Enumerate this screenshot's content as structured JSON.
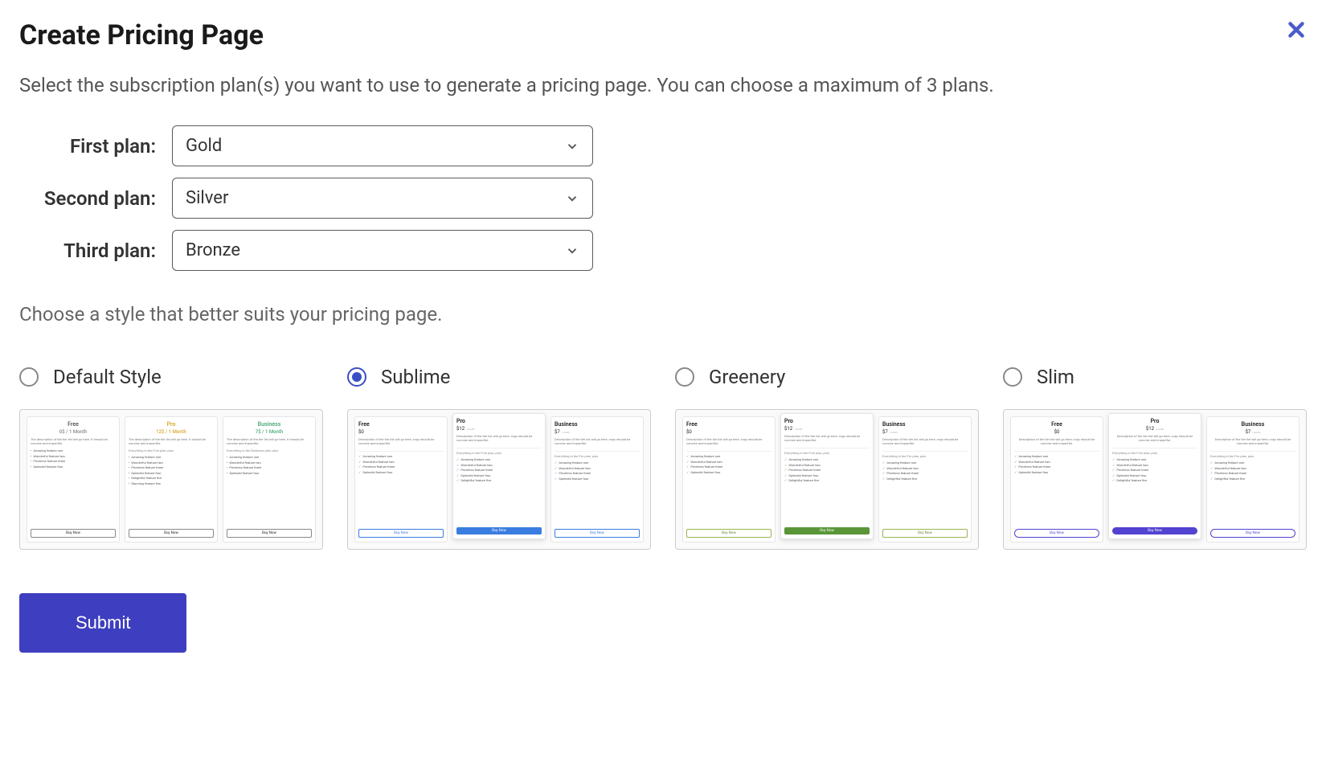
{
  "header": {
    "title": "Create Pricing Page"
  },
  "subtitle": "Select the subscription plan(s) you want to use to generate a pricing page. You can choose a maximum of 3 plans.",
  "plans": {
    "first": {
      "label": "First plan:",
      "value": "Gold"
    },
    "second": {
      "label": "Second plan:",
      "value": "Silver"
    },
    "third": {
      "label": "Third plan:",
      "value": "Bronze"
    }
  },
  "style_section": {
    "subtitle": "Choose a style that better suits your pricing page.",
    "options": [
      {
        "label": "Default Style",
        "selected": false
      },
      {
        "label": "Sublime",
        "selected": true
      },
      {
        "label": "Greenery",
        "selected": false
      },
      {
        "label": "Slim",
        "selected": false
      }
    ]
  },
  "preview_tiers": {
    "free": {
      "name": "Free",
      "price_default": "0$ / 1 Month",
      "price": "$0"
    },
    "pro": {
      "name": "Pro",
      "price_default": "12$ / 1 Month",
      "price": "$12",
      "per": "/ month"
    },
    "business": {
      "name": "Business",
      "price_default": "7$ / 1 Month",
      "price": "$7",
      "per": "/ month"
    }
  },
  "preview_text": {
    "desc": "Description of the tier list will go here, copy should be concise and impactful.",
    "desc_short": "The description of the tier list will go here. It should be concise and impactful.",
    "sub_pro": "Everything in the Free plan, plus",
    "sub_biz": "Everything in the Pro plan, plus",
    "sub_biz2": "Everything in the Business plan, plus",
    "features": {
      "f1": "Amazing feature one",
      "f2": "Wonderful feature two",
      "f3": "Priceless feature three",
      "f4": "Splendid feature four",
      "f5": "Delightful feature five",
      "f6": "Stunning feature five"
    },
    "buy": "Buy Now"
  },
  "submit_label": "Submit"
}
